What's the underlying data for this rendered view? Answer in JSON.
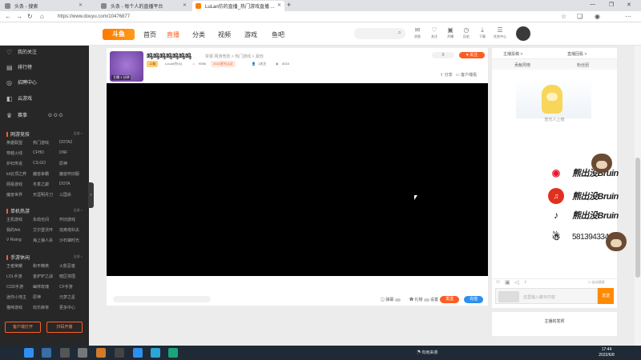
{
  "browser": {
    "tabs": [
      {
        "label": "头条 - 搜索"
      },
      {
        "label": "头条 - 每个人的直播平台"
      },
      {
        "label": "LuLan仿的直播_热门游戏直播 ..."
      }
    ],
    "url": "https://www.douyu.com/10476877",
    "new_tab": "+"
  },
  "header": {
    "logo": "斗鱼",
    "nav": [
      {
        "label": "首页"
      },
      {
        "label": "直播"
      },
      {
        "label": "分类"
      },
      {
        "label": "视频"
      },
      {
        "label": "游戏"
      },
      {
        "label": "鱼吧"
      }
    ],
    "icons": [
      {
        "label": "消息"
      },
      {
        "label": "关注"
      },
      {
        "label": "开播"
      },
      {
        "label": "历史"
      },
      {
        "label": "下载"
      },
      {
        "label": "任务中心"
      }
    ]
  },
  "sidebar": {
    "top_items": [
      {
        "label": "我的关注"
      },
      {
        "label": "排行榜"
      },
      {
        "label": "招聘中心"
      },
      {
        "label": "云游戏"
      },
      {
        "label": "赛事"
      }
    ],
    "sections": [
      {
        "title": "网游竞技",
        "more": "全部 >",
        "items": [
          "英雄联盟",
          "热门游戏",
          "DOTA2",
          "穿越火线",
          "CFHD",
          "DNF",
          "炉石传说",
          "CS:GO",
          "原神",
          "lol云顶之弈",
          "魔兽争霸",
          "魔兽怀旧服",
          "网易游戏",
          "冬季之巅",
          "DOTA",
          "魔兽世界",
          "天涯明月刀",
          "三国杀"
        ]
      },
      {
        "title": "单机热游",
        "more": "全部 >",
        "items": [
          "主机游戏",
          "永劫无间",
          "怀旧游戏",
          "我的Ark",
          "艾尔登法环",
          "逃离塔科夫",
          "V Rising",
          "海上狼人杀",
          "沙石镇时光"
        ]
      },
      {
        "title": "手游休闲",
        "more": "全部 >",
        "items": [
          "王者荣耀",
          "和平精英",
          "火影忍者",
          "LOL手游",
          "金铲铲之战",
          "暗区突围",
          "COD手游",
          "幽林玫瑰",
          "CF手游",
          "迷你小地主",
          "原神",
          "元梦之星",
          "猫咪游戏",
          "欢乐麻将",
          "更多中心"
        ]
      }
    ],
    "buttons": [
      {
        "label": "客户端打开"
      },
      {
        "label": "扫码开播"
      }
    ],
    "collapse": "‹"
  },
  "room": {
    "title": "呜呜呜呜呜呜呜",
    "streamer": "LuLan仿VQ",
    "level": "12级",
    "meta": "举报  网游竞技 > 热门游戏 > 其他",
    "hot": "9056",
    "gift_badge": "2021星光认证",
    "fans": "1关注",
    "viewers": "8315",
    "follow_count": "0",
    "follow_label": "关注",
    "share": "分享",
    "download": "客户端看",
    "avatar_tag": "主播  1  分钟"
  },
  "player": {
    "danmu_label": "弹幕",
    "gift_label": "礼物",
    "settings_label": "设置",
    "btn_orange": "发送",
    "btn_blue": "充值"
  },
  "chat": {
    "header_left": "主播投稿 >",
    "header_right": "直播回看 >",
    "tabs": [
      "贡献周榜",
      "粉丝团"
    ],
    "empty": "暂无人上榜",
    "input_placeholder": "这里输入聊天内容",
    "send": "发送",
    "autoscroll": "自动滚屏",
    "fan_card": "主播的发邦"
  },
  "overlay": {
    "weibo": "熊出没Bruin",
    "netease": "熊出没Bruin",
    "douyin": "熊出没Bruin",
    "qq": "581394334"
  },
  "taskbar": {
    "tray_text": "有雨来袭",
    "time": "17:44",
    "date": "2022/6/8"
  },
  "colors": {
    "accent": "#ff5d23",
    "sidebar": "#272727",
    "video": "#000000"
  }
}
